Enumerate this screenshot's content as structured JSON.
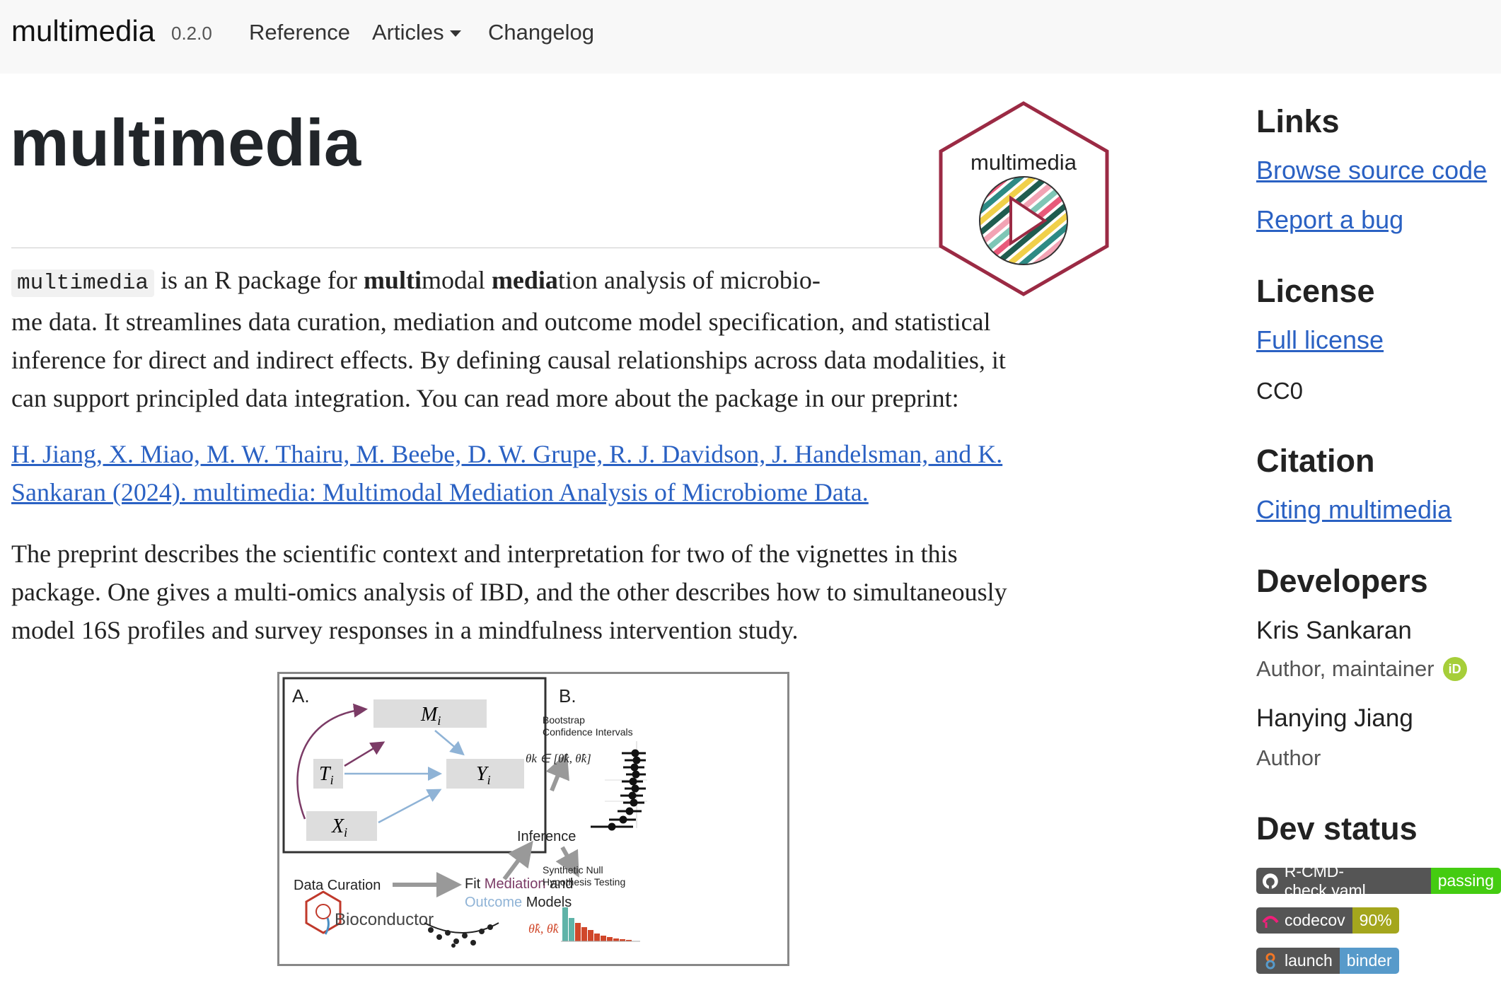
{
  "nav": {
    "brand": "multimedia",
    "version": "0.2.0",
    "links": [
      {
        "label": "Reference"
      },
      {
        "label": "Articles"
      },
      {
        "label": "Changelog"
      }
    ]
  },
  "title": "multimedia",
  "logo": {
    "text": "multimedia",
    "border_color": "#9b2a44"
  },
  "intro": {
    "code": "multimedia",
    "t1": " is an R package for ",
    "b1": "multi",
    "t2": "modal ",
    "b2": "media",
    "t3": "tion analysis of microbio-",
    "line2": "me data. It streamlines data curation, mediation and outcome model specification, and statistical",
    "line3": "inference for direct and indirect effects. By defining causal relationships across data modalities, it",
    "line4": "can support principled data integration. You can read more about the package in our preprint:"
  },
  "citation_link": {
    "line1": "H. Jiang, X. Miao, M. W. Thairu, M. Beebe, D. W. Grupe, R. J. Davidson, J. Handelsman, and K.",
    "line2": "Sankaran (2024). multimedia: Multimodal Mediation Analysis of Microbiome Data."
  },
  "description": {
    "line1": "The preprint describes the scientific context and interpretation for two of the vignettes in this",
    "line2": "package. One gives a multi-omics analysis of IBD, and the other describes how to simultaneously",
    "line3": "model 16S profiles and survey responses in a mindfulness intervention study."
  },
  "figure": {
    "panel_a": "A.",
    "panel_b": "B.",
    "m": "M",
    "t": "T",
    "y": "Y",
    "x": "X",
    "sub": "i",
    "data_curation": "Data Curation",
    "fit": "Fit",
    "mediation": "Mediation",
    "and": "and",
    "outcome": "Outcome",
    "models": "Models",
    "bioconductor": "Bioconductor",
    "inference": "Inference",
    "bootstrap": "Bootstrap",
    "confidence": "Confidence Intervals",
    "synthetic": "Synthetic Null",
    "hypothesis": "Hypothesis Testing",
    "theta_formula": "θk ∈ [θ̂k, θ̂k]",
    "theta_pair": "θ̂k, θ̂k"
  },
  "sidebar": {
    "links_heading": "Links",
    "browse": "Browse source code",
    "report": "Report a bug",
    "license_heading": "License",
    "full_license": "Full license",
    "license": "CC0",
    "citation_heading": "Citation",
    "citing": "Citing multimedia",
    "developers_heading": "Developers",
    "developers": [
      {
        "name": "Kris Sankaran",
        "role": "Author, maintainer"
      },
      {
        "name": "Hanying Jiang",
        "role": "Author"
      }
    ],
    "devstatus_heading": "Dev status",
    "badges": [
      {
        "left": "R-CMD-check.yaml",
        "right": "passing",
        "color": "#4c1"
      },
      {
        "left": "codecov",
        "right": "90%",
        "color": "#a4a61d"
      },
      {
        "left": "launch",
        "right": "binder",
        "color": "#579aca"
      }
    ]
  },
  "colors": {
    "link": "#2a61c3",
    "purple": "#7b3b66",
    "teal": "#5fb3a8",
    "red": "#d0472a",
    "light_blue": "#8fb3d6"
  },
  "icons": [
    "caret-down-icon",
    "orcid-icon",
    "github-icon",
    "codecov-icon",
    "binder-icon"
  ]
}
